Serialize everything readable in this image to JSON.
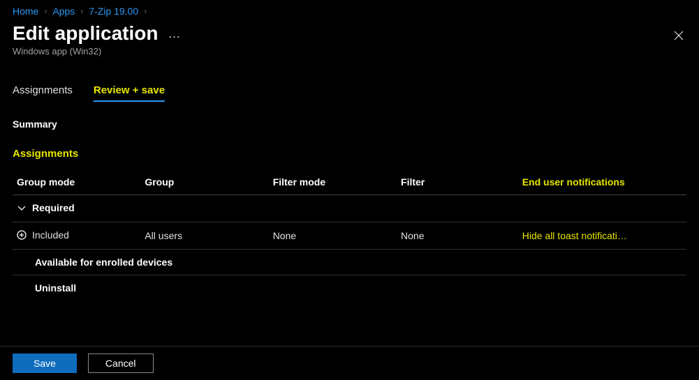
{
  "breadcrumb": {
    "home": "Home",
    "apps": "Apps",
    "app": "7-Zip 19.00"
  },
  "header": {
    "title": "Edit application",
    "subtitle": "Windows app (Win32)"
  },
  "tabs": {
    "assignments": "Assignments",
    "review_save": "Review + save"
  },
  "summary_label": "Summary",
  "assignments_heading": "Assignments",
  "columns": {
    "group_mode": "Group mode",
    "group": "Group",
    "filter_mode": "Filter mode",
    "filter": "Filter",
    "end_user_notifications": "End user notifications"
  },
  "rows": {
    "required_label": "Required",
    "included": {
      "mode": "Included",
      "group": "All users",
      "filter_mode": "None",
      "filter": "None",
      "notifications": "Hide all toast notificati…"
    },
    "available_label": "Available for enrolled devices",
    "uninstall_label": "Uninstall"
  },
  "buttons": {
    "save": "Save",
    "cancel": "Cancel"
  }
}
